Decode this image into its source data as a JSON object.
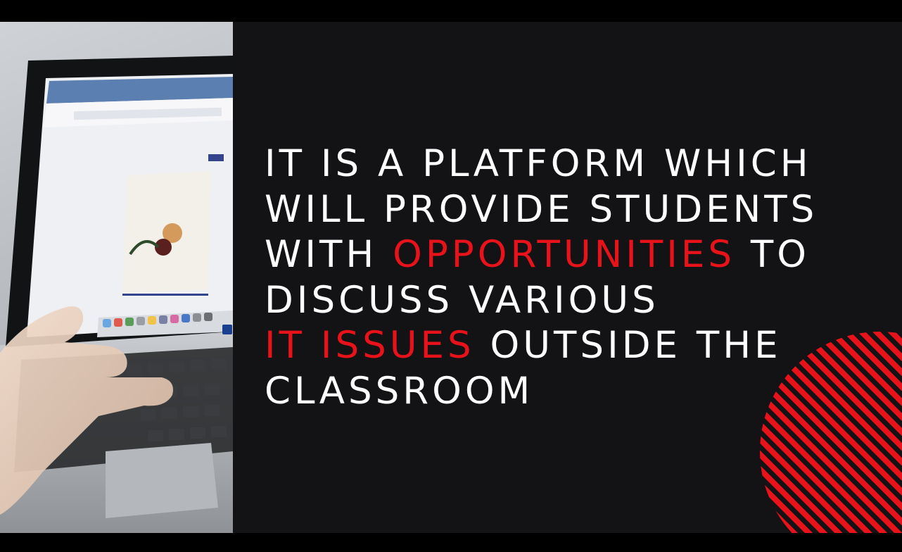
{
  "slide": {
    "lines": [
      [
        {
          "text": "IT IS A PLATFORM WHICH",
          "accent": false
        }
      ],
      [
        {
          "text": "WILL PROVIDE STUDENTS",
          "accent": false
        }
      ],
      [
        {
          "text": "WITH ",
          "accent": false
        },
        {
          "text": "OPPORTUNITIES",
          "accent": true
        },
        {
          "text": " TO",
          "accent": false
        }
      ],
      [
        {
          "text": "DISCUSS VARIOUS",
          "accent": false
        }
      ],
      [
        {
          "text": "IT ISSUES",
          "accent": true
        },
        {
          "text": " OUTSIDE THE",
          "accent": false
        }
      ],
      [
        {
          "text": "CLASSROOM",
          "accent": false
        }
      ]
    ]
  },
  "colors": {
    "background": "#131214",
    "text": "#ffffff",
    "accent": "#e8131a",
    "letterbox": "#000000"
  },
  "icons": {
    "photo": "laptop-hand-photo",
    "decoration": "striped-circle-decoration"
  }
}
